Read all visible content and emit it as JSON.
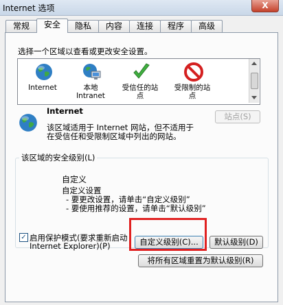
{
  "window": {
    "title": "Internet 选项",
    "close_label": "X"
  },
  "tabs": [
    {
      "label": "常规"
    },
    {
      "label": "安全"
    },
    {
      "label": "隐私"
    },
    {
      "label": "内容"
    },
    {
      "label": "连接"
    },
    {
      "label": "程序"
    },
    {
      "label": "高级"
    }
  ],
  "active_tab": "安全",
  "zones_prompt": "选择一个区域以查看或更改安全设置。",
  "zones": [
    {
      "label": "Internet",
      "icon": "globe-icon"
    },
    {
      "label": "本地\nIntranet",
      "icon": "intranet-icon"
    },
    {
      "label": "受信任的站\n点",
      "icon": "checkmark-icon"
    },
    {
      "label": "受限制的站\n点",
      "icon": "no-entry-icon"
    }
  ],
  "selected_zone": {
    "title": "Internet",
    "description_line1": "该区域适用于 Internet 网站，但不适用于",
    "description_line2": "在受信任和受限制区域中列出的网站。",
    "sites_button": "站点(S)"
  },
  "security_level": {
    "group_label": "该区域的安全级别(L)",
    "level_title": "自定义",
    "line1": "自定义设置",
    "line2": "- 要更改设置，请单击“自定义级别”",
    "line3": "- 要使用推荐的设置，请单击“默认级别”"
  },
  "protected_mode": {
    "checked": true,
    "label_line1": "启用保护模式(要求重新启动",
    "label_line2": "Internet Explorer)(P)"
  },
  "buttons": {
    "custom_level": "自定义级别(C)...",
    "default_level": "默认级别(D)",
    "reset_all": "将所有区域重置为默认级别(R)"
  },
  "colors": {
    "highlight": "#e02020",
    "titlebar": "#c9d7e8"
  }
}
